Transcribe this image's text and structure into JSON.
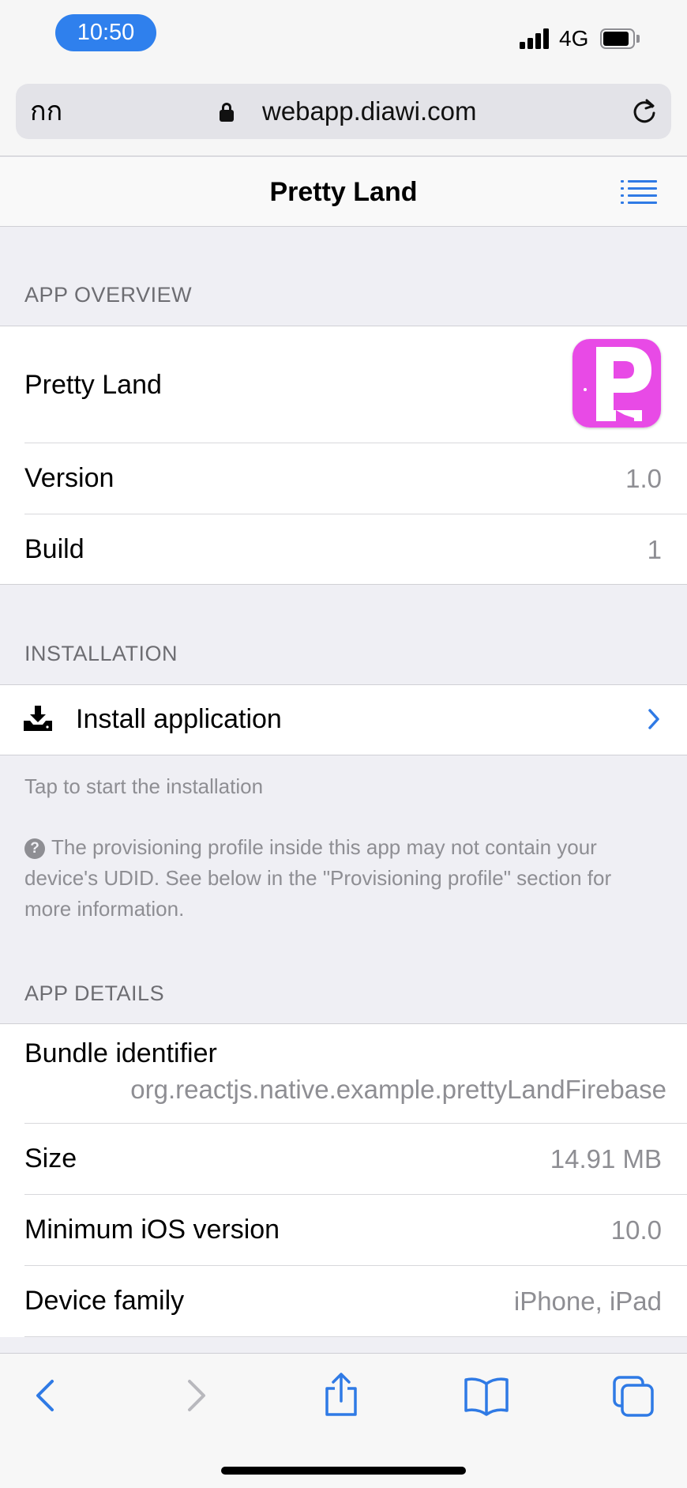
{
  "status_bar": {
    "time": "10:50",
    "network": "4G",
    "accent_color": "#2f80ed"
  },
  "browser": {
    "reader_label": "กก",
    "url": "webapp.diawi.com",
    "reload_icon": "reload-icon"
  },
  "navbar": {
    "title": "Pretty Land",
    "menu_icon": "list-menu-icon"
  },
  "app_overview": {
    "header": "APP OVERVIEW",
    "app_name": "Pretty Land",
    "icon_letter": "P",
    "version_label": "Version",
    "version_value": "1.0",
    "build_label": "Build",
    "build_value": "1"
  },
  "installation": {
    "header": "INSTALLATION",
    "install_label": "Install application",
    "install_hint": "Tap to start the installation",
    "provision_note": "The provisioning profile inside this app may not contain your device's UDID. See below in the \"Provisioning profile\" section for more information."
  },
  "app_details": {
    "header": "APP DETAILS",
    "bundle_label": "Bundle identifier",
    "bundle_value": "org.reactjs.native.example.prettyLandFirebase",
    "size_label": "Size",
    "size_value": "14.91 MB",
    "min_ios_label": "Minimum iOS version",
    "min_ios_value": "10.0",
    "device_family_label": "Device family",
    "device_family_value": "iPhone, iPad"
  },
  "colors": {
    "link_blue": "#2f7ae5",
    "app_icon_pink": "#e84ae6"
  }
}
